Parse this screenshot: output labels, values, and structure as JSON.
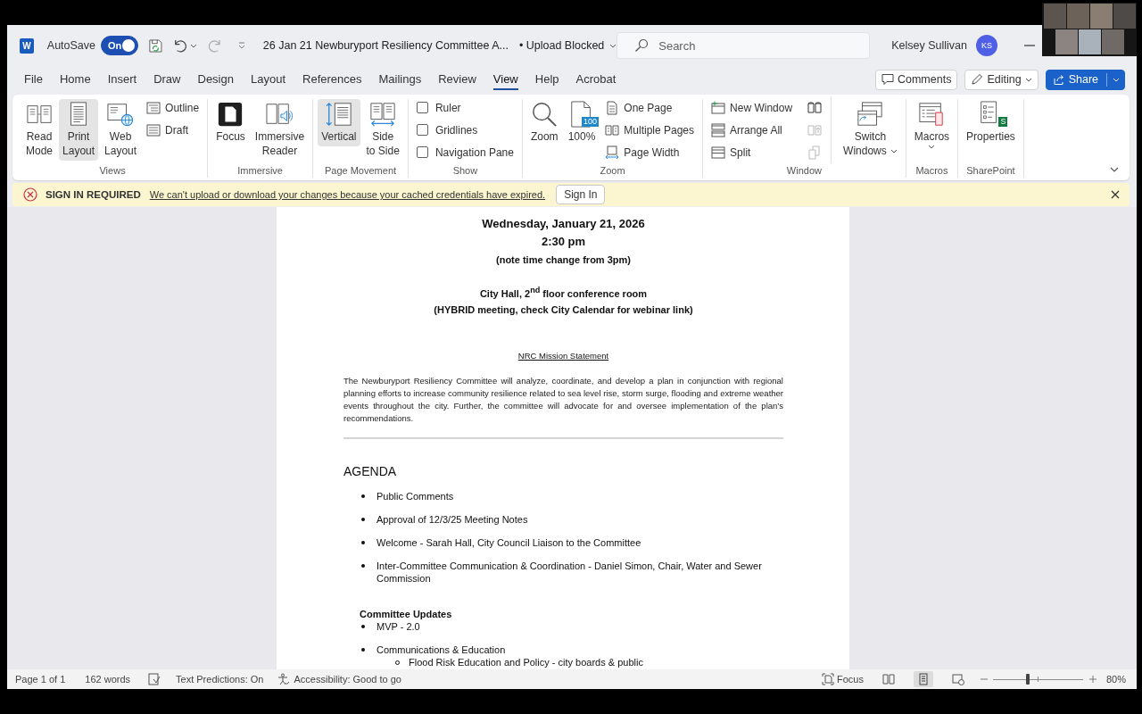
{
  "video_preview": {
    "tiles": [
      {
        "kind": "photo"
      },
      {
        "kind": "photo"
      },
      {
        "kind": "photo"
      },
      {
        "kind": "photo"
      },
      {
        "kind": "photo"
      },
      {
        "kind": "photo"
      },
      {
        "kind": "photo"
      }
    ]
  },
  "title_bar": {
    "app_letter": "W",
    "autosave": {
      "label": "AutoSave",
      "state_text": "On",
      "on": true
    },
    "document_title": "26 Jan 21 Newburyport Resiliency Committee A...",
    "upload_status": "• Upload Blocked",
    "search": {
      "placeholder": "Search"
    },
    "user": {
      "name": "Kelsey Sullivan",
      "initials": "KS"
    }
  },
  "menu_tabs": [
    {
      "label": "File",
      "selected": false
    },
    {
      "label": "Home",
      "selected": false
    },
    {
      "label": "Insert",
      "selected": false
    },
    {
      "label": "Draw",
      "selected": false
    },
    {
      "label": "Design",
      "selected": false
    },
    {
      "label": "Layout",
      "selected": false
    },
    {
      "label": "References",
      "selected": false
    },
    {
      "label": "Mailings",
      "selected": false
    },
    {
      "label": "Review",
      "selected": false
    },
    {
      "label": "View",
      "selected": true
    },
    {
      "label": "Help",
      "selected": false
    },
    {
      "label": "Acrobat",
      "selected": false
    }
  ],
  "header_buttons": {
    "comments": "Comments",
    "editing": "Editing",
    "share": "Share"
  },
  "ribbon": {
    "groups": [
      {
        "label": "Views",
        "items": [
          {
            "kind": "large",
            "label": "Read\nMode",
            "selected": false
          },
          {
            "kind": "large",
            "label": "Print\nLayout",
            "selected": true
          },
          {
            "kind": "large",
            "label": "Web\nLayout",
            "selected": false
          },
          {
            "kind": "small",
            "label": "Outline",
            "selected": false
          },
          {
            "kind": "small",
            "label": "Draft",
            "selected": false
          }
        ]
      },
      {
        "label": "Immersive",
        "items": [
          {
            "kind": "large",
            "label": "Focus"
          },
          {
            "kind": "large",
            "label": "Immersive\nReader"
          }
        ]
      },
      {
        "label": "Page Movement",
        "items": [
          {
            "kind": "large",
            "label": "Vertical",
            "selected": true
          },
          {
            "kind": "large",
            "label": "Side\nto Side",
            "selected": false
          }
        ]
      },
      {
        "label": "Show",
        "items": [
          {
            "kind": "checkbox",
            "label": "Ruler",
            "checked": false
          },
          {
            "kind": "checkbox",
            "label": "Gridlines",
            "checked": false
          },
          {
            "kind": "checkbox",
            "label": "Navigation Pane",
            "checked": false
          }
        ]
      },
      {
        "label": "Zoom",
        "items": [
          {
            "kind": "large",
            "label": "Zoom"
          },
          {
            "kind": "large",
            "label": "100%",
            "badge": {
              "text": "100",
              "color": "#1e88c8"
            }
          },
          {
            "kind": "small",
            "label": "One Page"
          },
          {
            "kind": "small",
            "label": "Multiple Pages"
          },
          {
            "kind": "small",
            "label": "Page Width"
          }
        ]
      },
      {
        "label": "Window",
        "items": [
          {
            "kind": "small",
            "label": "New Window"
          },
          {
            "kind": "small",
            "label": "Arrange All"
          },
          {
            "kind": "small",
            "label": "Split"
          },
          {
            "kind": "icon",
            "disabled": false
          },
          {
            "kind": "icon",
            "disabled": true
          },
          {
            "kind": "icon",
            "disabled": true
          },
          {
            "kind": "large",
            "label": "Switch\nWindows"
          }
        ]
      },
      {
        "label": "Macros",
        "items": [
          {
            "kind": "large",
            "label": "Macros"
          }
        ]
      },
      {
        "label": "SharePoint",
        "items": [
          {
            "kind": "large",
            "label": "Properties",
            "badge": {
              "text": "S",
              "color": "#107c41"
            }
          }
        ]
      }
    ]
  },
  "message_bar": {
    "kind": "error",
    "title": "SIGN IN REQUIRED",
    "message": "We can't upload or download your changes because your cached credentials have expired.",
    "button": "Sign In"
  },
  "document": {
    "meeting": {
      "date": "Wednesday, January 21, 2026",
      "time": "2:30 pm",
      "time_note": "(note time change from 3pm)",
      "location": "City Hall, 2$^{nd}$ floor conference room",
      "format_note": "(HYBRID meeting, check City Calendar for webinar link)"
    },
    "mission": {
      "heading": "NRC Mission Statement",
      "text": "The Newburyport Resiliency Committee will analyze, coordinate, and develop a plan in conjunction with regional planning efforts to increase community resilience related to sea level rise, storm surge, flooding and extreme weather events throughout the city. Further, the committee will advocate for and oversee implementation of the plan’s recommendations."
    },
    "agenda": {
      "heading": "AGENDA",
      "items": [
        {
          "text": "Public Comments"
        },
        {
          "text": "Approval of 12/3/25 Meeting Notes"
        },
        {
          "text": "Welcome - Sarah Hall, City Council Liaison to the Committee"
        },
        {
          "text": "Inter-Committee Communication & Coordination - Daniel Simon, Chair, Water and Sewer Commission"
        }
      ],
      "sections": [
        {
          "heading": "Committee Updates",
          "items": [
            {
              "text": "MVP - 2.0"
            },
            {
              "text": "Communications & Education",
              "children": [
                {
                  "text": "Flood Risk Education and Policy - city boards & public"
                }
              ]
            }
          ]
        }
      ]
    }
  },
  "status_bar": {
    "page": "Page 1 of 1",
    "words": "162 words",
    "text_predictions": "Text Predictions: On",
    "accessibility": "Accessibility: Good to go",
    "focus": "Focus",
    "views": [
      {
        "selected": false
      },
      {
        "selected": true
      },
      {
        "selected": false
      }
    ],
    "zoom": {
      "level": 0.39,
      "reading": "80%"
    }
  }
}
